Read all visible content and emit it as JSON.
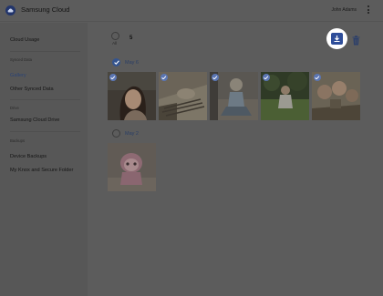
{
  "header": {
    "app_title": "Samsung Cloud",
    "user_name": "John Adams"
  },
  "sidebar": {
    "cloud_usage": "Cloud Usage",
    "synced_section": "Synced Data",
    "gallery": "Gallery",
    "other_synced": "Other Synced Data",
    "drive_section": "Drive",
    "cloud_drive": "Samsung Cloud Drive",
    "backups_section": "Backups",
    "device_backups": "Device Backups",
    "knox": "My Knox and Secure Folder"
  },
  "toolbar": {
    "select_all_label": "All",
    "selected_count": "5"
  },
  "groups": [
    {
      "date": "May 6",
      "selected": true,
      "photos": [
        "woman-portrait",
        "dog-on-bed",
        "child-sitting",
        "child-on-grass",
        "group-selfie"
      ]
    },
    {
      "date": "May 2",
      "selected": false,
      "photos": [
        "pink-plush-toy"
      ]
    }
  ],
  "colors": {
    "accent": "#2f4e9a",
    "overlay": "#5c5c5c"
  }
}
